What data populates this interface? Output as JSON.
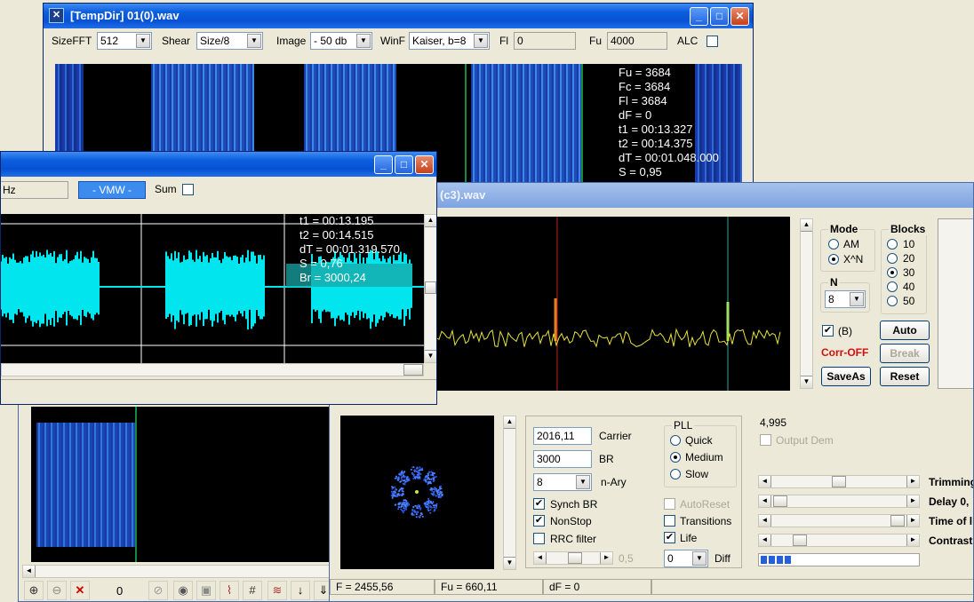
{
  "win1": {
    "title": "[TempDir] 01(0).wav",
    "sizefft_label": "SizeFFT",
    "sizefft_value": "512",
    "shear_label": "Shear",
    "shear_value": "Size/8",
    "image_label": "Image",
    "image_value": "- 50 db",
    "winf_label": "WinF",
    "winf_value": "Kaiser, b=8",
    "fl_label": "Fl",
    "fl_value": "0",
    "fu_label": "Fu",
    "fu_value": "4000",
    "alc_label": "ALC",
    "readout": [
      "Fu = 3684",
      "Fc = 3684",
      "Fl = 3684",
      "dF = 0",
      "t1 = 00:13.327",
      "t2 = 00:14.375",
      "dT = 00:01.048.000",
      "S = 0,95"
    ]
  },
  "win2": {
    "hz_value": "Hz",
    "vmw_label": "- VMW -",
    "sum_label": "Sum",
    "readout": [
      "t1 = 00:13.195",
      "t2 = 00:14.515",
      "dT = 00:01.319.570",
      "S = 0,76",
      "Br = 3000,24"
    ]
  },
  "win3": {
    "title": "(c3).wav",
    "mode_label": "Mode",
    "mode_options": [
      "AM",
      "X^N"
    ],
    "mode_selected": "X^N",
    "blocks_label": "Blocks",
    "blocks_options": [
      "10",
      "20",
      "30",
      "40",
      "50"
    ],
    "blocks_selected": "30",
    "n_label": "N",
    "n_value": "8",
    "b_label": "(B)",
    "corr_label": "Corr-OFF",
    "auto_button": "Auto",
    "break_button": "Break",
    "saveas_button": "SaveAs",
    "reset_button": "Reset"
  },
  "win4": {
    "value_display": "4,995",
    "output_dem_label": "Output Dem",
    "carrier_value": "2016,11",
    "carrier_label": "Carrier",
    "br_value": "3000",
    "br_label": "BR",
    "nary_value": "8",
    "nary_label": "n-Ary",
    "synch_br_label": "Synch BR",
    "nonstop_label": "NonStop",
    "rrc_label": "RRC filter",
    "rrc_value": "0,5",
    "pll_label": "PLL",
    "pll_options": [
      "Quick",
      "Medium",
      "Slow"
    ],
    "pll_selected": "Medium",
    "autoreset_label": "AutoReset",
    "transitions_label": "Transitions",
    "life_label": "Life",
    "diff_value": "0",
    "diff_label": "Diff",
    "trimming_label": "Trimming",
    "delay_label": "Delay 0,",
    "timeof_label": "Time of li",
    "contrast_label": "Contrast -",
    "status_f": "F = 2455,56",
    "status_fu": "Fu = 660,11",
    "status_df": "dF = 0"
  },
  "toolbar": {
    "counter": "0"
  },
  "colors": {
    "title_bar": "#0852d4",
    "wave": "#00e5ee",
    "trace": "#e6e23a",
    "marker_red": "#d02020",
    "marker_green": "#10c060"
  }
}
